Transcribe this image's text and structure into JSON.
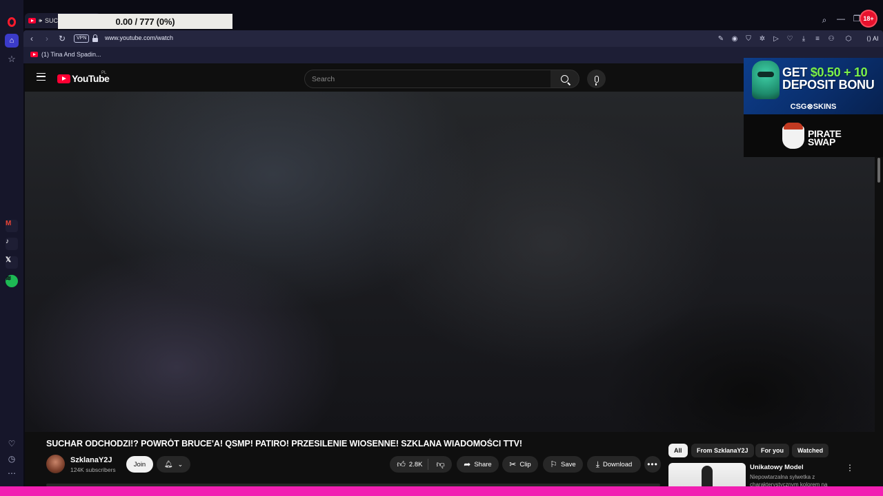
{
  "browser": {
    "tab": {
      "title": "SUCH",
      "audio_icon": "speaker-icon"
    },
    "progress_overlay": "0.00 / 777 (0%)",
    "age_badge": "18+",
    "address": {
      "vpn_label": "VPN",
      "url": "www.youtube.com/watch"
    },
    "ai_label": "AI",
    "bookmark": {
      "label": "(1) Tina And Spadin..."
    },
    "sidebar_icons": [
      "opera-logo",
      "home-icon",
      "star-icon",
      "gmail-icon",
      "tiktok-icon",
      "x-icon",
      "spotify-icon",
      "heart-icon",
      "history-icon",
      "more-icon"
    ]
  },
  "youtube": {
    "logo_text": "YouTube",
    "country_code": "PL",
    "search": {
      "placeholder": "Search"
    },
    "video": {
      "title": "SUCHAR ODCHODZI!? POWRÓT BRUCE'A! QSMP! PATIRO! PRZESILENIE WIOSENNE! SZKLANA WIADOMOŚCI TTV!",
      "channel": "SzklanaY2J",
      "subscribers": "124K subscribers",
      "join_label": "Join",
      "likes": "2.8K",
      "share_label": "Share",
      "clip_label": "Clip",
      "save_label": "Save",
      "download_label": "Download"
    },
    "chips": [
      "All",
      "From SzklanaY2J",
      "For you",
      "Watched"
    ],
    "recommendation": {
      "title": "Unikatowy Model",
      "description": "Niepowtarzalna sylwetka z charakterystycznym kolorem na okładce w..."
    }
  },
  "ad": {
    "headline_line1_prefix": "GET ",
    "headline_line1_accent": "$0.50 + 10",
    "headline_line2": "DEPOSIT BONU",
    "brand": "CSG⊗SKINS",
    "partner_logo": "PIRATE\nSWAP"
  },
  "colors": {
    "youtube_red": "#ff0033",
    "opera_red": "#ff1b2d",
    "sidebar_accent": "#3b3bc9",
    "bottom_strip": "#f11fb2"
  }
}
